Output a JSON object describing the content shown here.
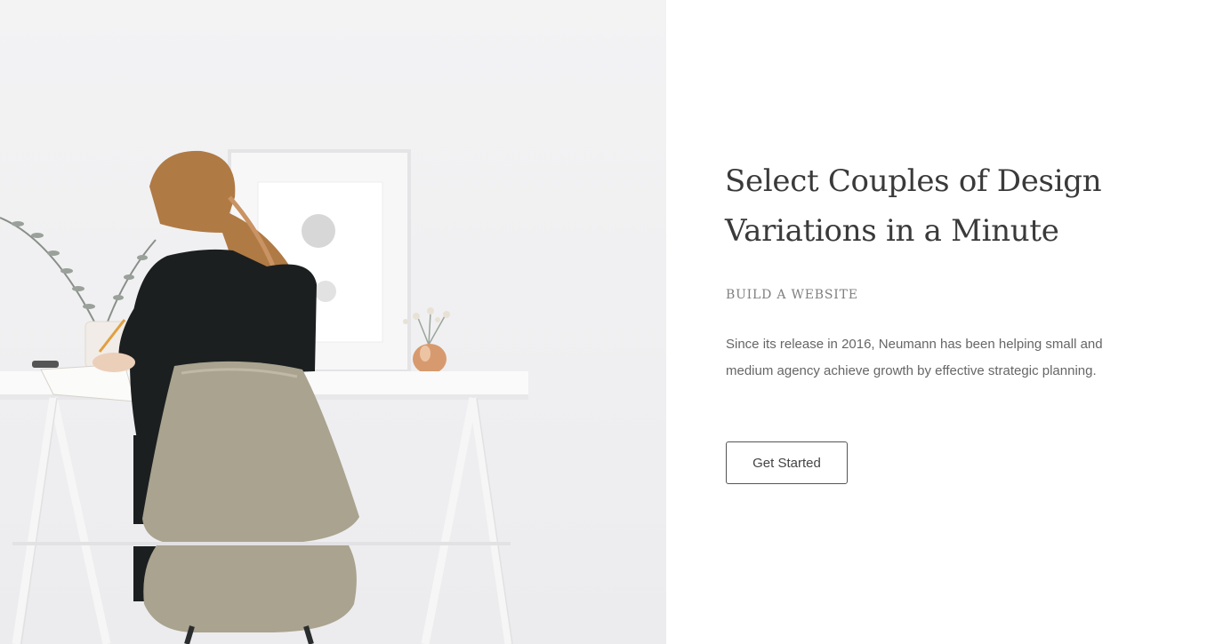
{
  "hero": {
    "image_alt": "Woman writing at a white desk",
    "colors": {
      "panel_bg": "#efeff1",
      "hair": "#b07a45",
      "sweater": "#1b1f20",
      "chair": "#a9a38f",
      "vase": "#d79a6e"
    }
  },
  "content": {
    "heading": "Select Couples of Design Variations in a Minute",
    "subheading": "BUILD A WEBSITE",
    "description": "Since its release in 2016, Neumann has been helping small and medium agency achieve growth by effective strategic planning.",
    "cta_label": "Get Started"
  }
}
